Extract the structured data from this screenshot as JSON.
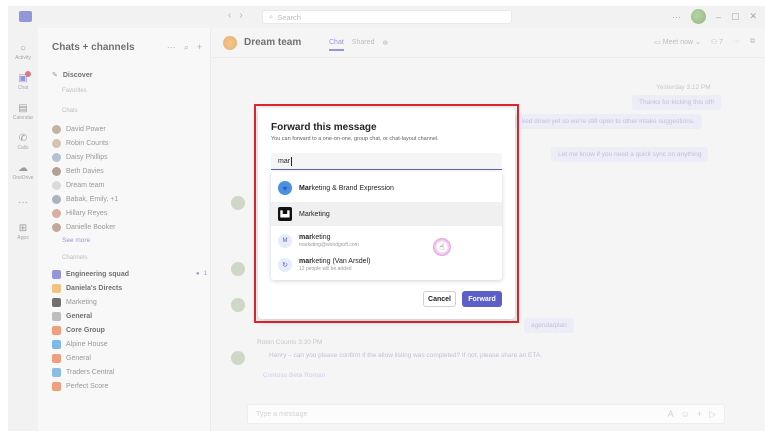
{
  "titlebar": {
    "search_placeholder": "Search",
    "nav_back": "‹",
    "nav_forward": "›",
    "more": "···",
    "minimize": "–",
    "maximize": "▢",
    "close": "✕"
  },
  "rail": [
    {
      "label": "Activity",
      "icon": "bell-icon",
      "glyph": "○"
    },
    {
      "label": "Chat",
      "icon": "chat-icon",
      "glyph": "▣"
    },
    {
      "label": "Calendar",
      "icon": "calendar-icon",
      "glyph": "▤"
    },
    {
      "label": "Calls",
      "icon": "phone-icon",
      "glyph": "✆"
    },
    {
      "label": "OneDrive",
      "icon": "cloud-icon",
      "glyph": "☁"
    },
    {
      "label": "",
      "icon": "more-icon",
      "glyph": "···"
    },
    {
      "label": "Apps",
      "icon": "apps-icon",
      "glyph": "⊞"
    }
  ],
  "chatlist": {
    "title": "Chats + channels",
    "discover": "Discover",
    "section_favorites": "Favorites",
    "section_chats": "Chats",
    "chats": [
      {
        "name": "David Power",
        "color": "#a58b6f"
      },
      {
        "name": "Robin Counts",
        "color": "#c0a286"
      },
      {
        "name": "Daisy Phillips",
        "color": "#8aa0b8"
      },
      {
        "name": "Beth Davies",
        "color": "#8a6f5c"
      },
      {
        "name": "Dream team",
        "color": "#c8c8c8"
      },
      {
        "name": "Babak, Emily, +1",
        "color": "#7a8c9c"
      },
      {
        "name": "Hillary Reyes",
        "color": "#c9806a"
      },
      {
        "name": "Danielle Booker",
        "color": "#9e7d60"
      }
    ],
    "see_more": "See more",
    "section_channels": "Channels",
    "channels": [
      {
        "name": "Engineering squad",
        "bold": true,
        "color": "#5b5fc7",
        "badge": "1"
      },
      {
        "name": "Daniela's Directs",
        "bold": true,
        "color": "#e8a33b",
        "badge": ""
      },
      {
        "name": "Marketing",
        "bold": false,
        "color": "#242424",
        "badge": ""
      },
      {
        "name": "General",
        "bold": true,
        "color": "#9a9a9a",
        "badge": ""
      },
      {
        "name": "Core Group",
        "bold": true,
        "color": "#e86c3a",
        "badge": ""
      },
      {
        "name": "Alpine House",
        "bold": false,
        "color": "#3a96dd",
        "badge": ""
      },
      {
        "name": "General",
        "bold": false,
        "color": "#e86c3a",
        "badge": ""
      },
      {
        "name": "Traders Central",
        "bold": false,
        "color": "#4f9cd6",
        "badge": ""
      },
      {
        "name": "Perfect Score",
        "bold": false,
        "color": "#e86c3a",
        "badge": ""
      }
    ]
  },
  "main": {
    "title": "Dream team",
    "tab_chat": "Chat",
    "tab_shared": "Shared",
    "meet_now": "Meet now",
    "participants": "7",
    "messages": {
      "timestamp1": "Yesterday 3:12 PM",
      "bubble1": "Thanks for kicking this off!",
      "bubble2": "ked down yet so we're still open to other intake suggestions.",
      "bubble3": "Let me know if you need a quick sync on anything",
      "bubble4": "agenda/plan",
      "sender_line": "Robin Counts  3:30 PM",
      "text_line": "Henry – can you please confirm if the allow listing was completed? If not, please share an ETA.",
      "link": "Contoso Beta Roman"
    },
    "composer_placeholder": "Type a message"
  },
  "dialog": {
    "title": "Forward this message",
    "subtitle": "You can forward to a one-on-one, group chat, or chat-layout channel.",
    "input_value": "mar",
    "results": [
      {
        "match": "Mar",
        "rest": "keting & Brand Expression",
        "sub": "",
        "icon": "heart-icon"
      },
      {
        "match": "",
        "rest": "Marketing",
        "sub": "",
        "icon": "marketing-logo-icon"
      },
      {
        "match": "mar",
        "rest": "keting",
        "sub": "marketing@woodgroft.com",
        "icon": "initial-avatar-icon",
        "initial": "M"
      },
      {
        "match": "mar",
        "rest": "keting (Van Arsdel)",
        "sub": "12 people will be added",
        "icon": "group-icon"
      }
    ],
    "cancel_label": "Cancel",
    "forward_label": "Forward"
  }
}
